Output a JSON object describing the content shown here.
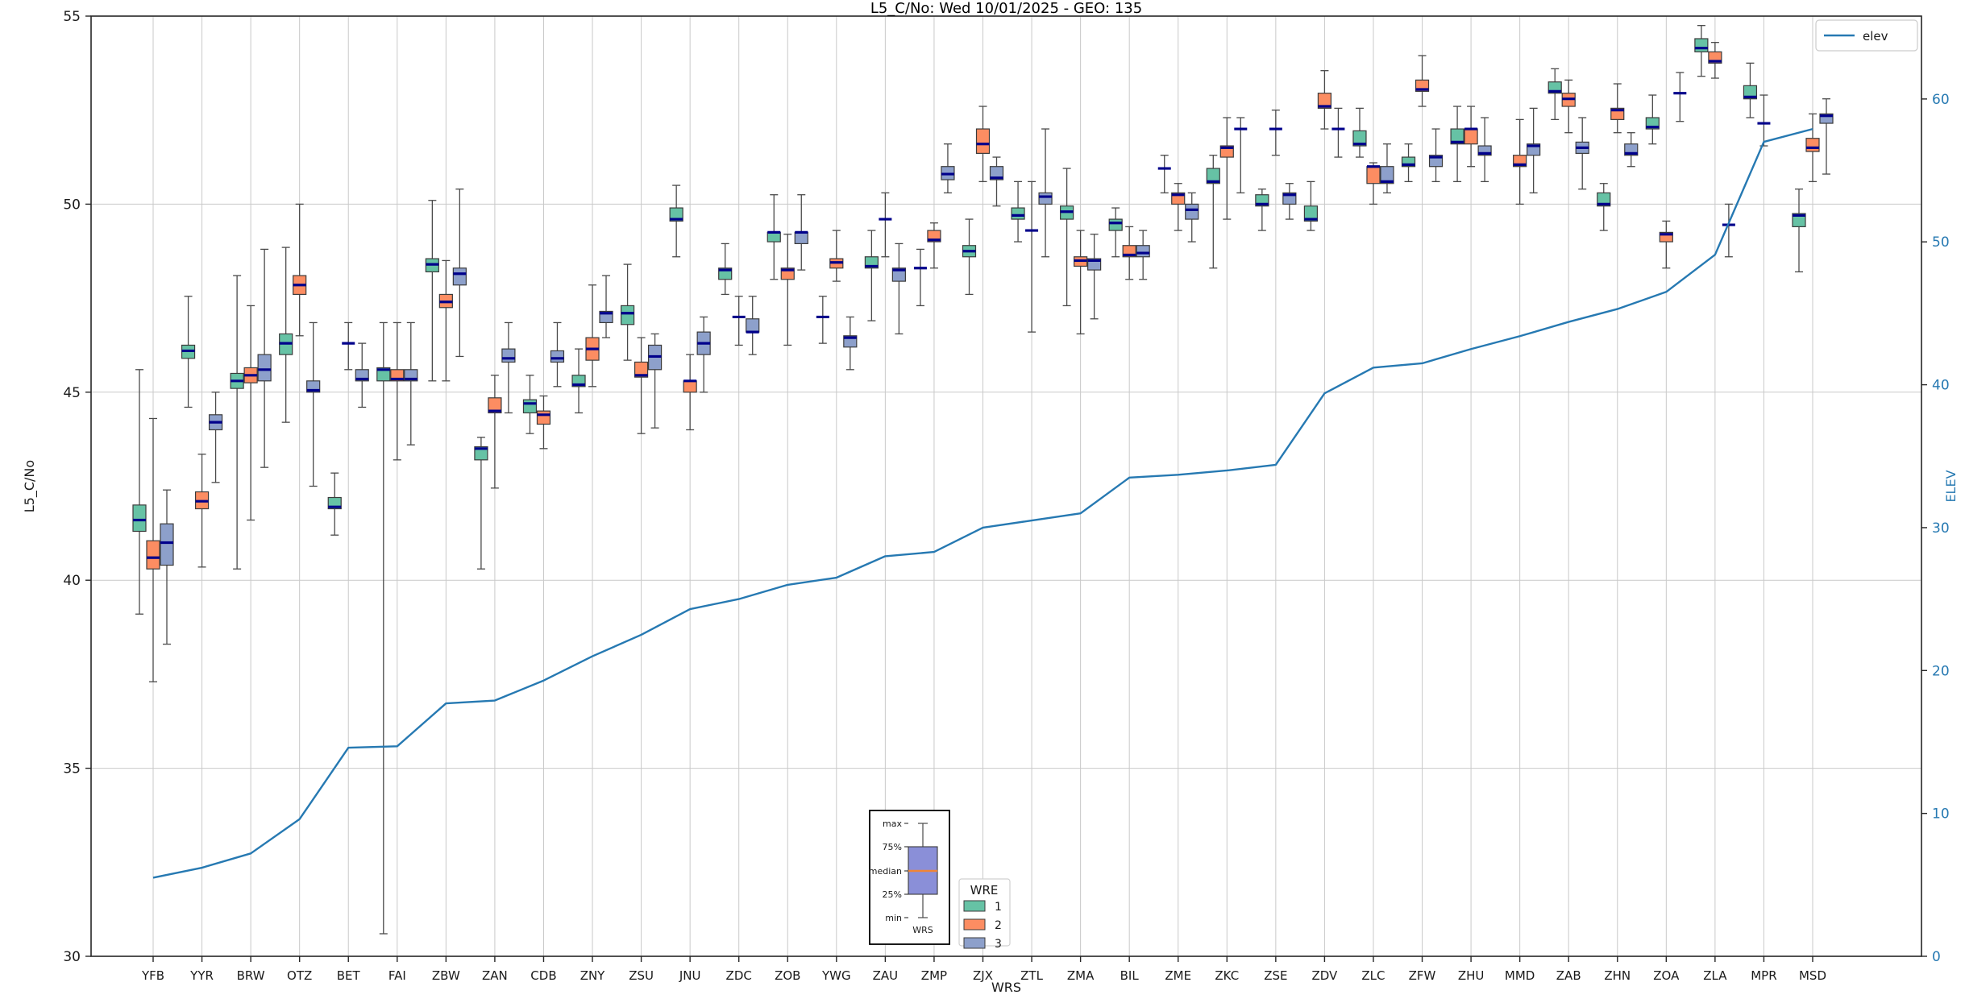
{
  "chart_data": {
    "type": "boxplot+line",
    "title": "L5_C/No: Wed 10/01/2025 - GEO: 135",
    "xlabel": "WRS",
    "ylabel": "L5_C/No",
    "y2label": "ELEV",
    "ylim": [
      30,
      55
    ],
    "yticks": [
      30,
      35,
      40,
      45,
      50,
      55
    ],
    "y2lim": [
      0,
      65.8
    ],
    "y2ticks": [
      0,
      10,
      20,
      30,
      40,
      50,
      60
    ],
    "grid": true,
    "legend_position": "upper-right",
    "categories": [
      "YFB",
      "YYR",
      "BRW",
      "OTZ",
      "BET",
      "FAI",
      "ZBW",
      "ZAN",
      "CDB",
      "ZNY",
      "ZSU",
      "JNU",
      "ZDC",
      "ZOB",
      "YWG",
      "ZAU",
      "ZMP",
      "ZJX",
      "ZTL",
      "ZMA",
      "BIL",
      "ZME",
      "ZKC",
      "ZSE",
      "ZDV",
      "ZLC",
      "ZFW",
      "ZHU",
      "MMD",
      "ZAB",
      "ZHN",
      "ZOA",
      "ZLA",
      "MPR",
      "MSD"
    ],
    "box_value_order": [
      "median",
      "q1",
      "q3",
      "whisker_low",
      "whisker_high"
    ],
    "series": [
      {
        "name": "1",
        "color": "#66c2a5",
        "boxes": [
          [
            41.6,
            41.3,
            42.0,
            39.1,
            45.6
          ],
          [
            46.1,
            45.9,
            46.25,
            44.6,
            47.55
          ],
          [
            45.3,
            45.1,
            45.5,
            40.3,
            48.1
          ],
          [
            46.3,
            46.0,
            46.55,
            44.2,
            48.85
          ],
          [
            41.95,
            41.9,
            42.2,
            41.2,
            42.85
          ],
          [
            45.6,
            45.3,
            45.65,
            30.6,
            46.85
          ],
          [
            48.4,
            48.2,
            48.55,
            45.3,
            50.1
          ],
          [
            43.5,
            43.2,
            43.55,
            40.3,
            43.8
          ],
          [
            44.7,
            44.45,
            44.8,
            43.9,
            45.45
          ],
          [
            45.2,
            45.15,
            45.45,
            44.45,
            46.15
          ],
          [
            47.1,
            46.8,
            47.3,
            45.85,
            48.4
          ],
          [
            49.6,
            49.55,
            49.9,
            48.6,
            50.5
          ],
          [
            48.25,
            48.0,
            48.3,
            47.6,
            48.95
          ],
          [
            49.25,
            49.0,
            49.25,
            48.0,
            50.25
          ],
          [
            47.0,
            47.0,
            47.0,
            46.3,
            47.55
          ],
          [
            48.35,
            48.3,
            48.6,
            46.9,
            49.3
          ],
          [
            48.3,
            48.3,
            48.3,
            47.3,
            48.8
          ],
          [
            48.75,
            48.6,
            48.9,
            47.6,
            49.6
          ],
          [
            49.7,
            49.6,
            49.9,
            49.0,
            50.6
          ],
          [
            49.8,
            49.6,
            49.95,
            47.3,
            50.95
          ],
          [
            49.5,
            49.3,
            49.6,
            48.6,
            49.9
          ],
          [
            50.95,
            50.95,
            50.95,
            50.3,
            51.3
          ],
          [
            50.6,
            50.55,
            50.95,
            48.3,
            51.3
          ],
          [
            50.0,
            49.95,
            50.25,
            49.3,
            50.4
          ],
          [
            49.6,
            49.55,
            49.95,
            49.3,
            50.6
          ],
          [
            51.6,
            51.55,
            51.95,
            51.25,
            52.55
          ],
          [
            51.05,
            51.0,
            51.25,
            50.6,
            51.6
          ],
          [
            51.65,
            51.6,
            52.0,
            50.6,
            52.6
          ],
          null,
          [
            53.0,
            52.95,
            53.25,
            52.25,
            53.6
          ],
          [
            50.0,
            49.95,
            50.3,
            49.3,
            50.55
          ],
          [
            52.05,
            52.0,
            52.3,
            51.6,
            52.9
          ],
          [
            54.15,
            54.05,
            54.4,
            53.4,
            54.75
          ],
          [
            52.85,
            52.8,
            53.15,
            52.3,
            53.75
          ],
          [
            49.7,
            49.4,
            49.75,
            48.2,
            50.4
          ]
        ]
      },
      {
        "name": "2",
        "color": "#fc8d62",
        "boxes": [
          [
            40.6,
            40.3,
            41.05,
            37.3,
            44.3
          ],
          [
            42.1,
            41.9,
            42.35,
            40.35,
            43.35
          ],
          [
            45.45,
            45.25,
            45.65,
            41.6,
            47.3
          ],
          [
            47.85,
            47.6,
            48.1,
            46.5,
            50.0
          ],
          [
            46.3,
            46.3,
            46.3,
            45.6,
            46.85
          ],
          [
            45.35,
            45.3,
            45.6,
            43.2,
            46.85
          ],
          [
            47.4,
            47.25,
            47.6,
            45.3,
            48.5
          ],
          [
            44.5,
            44.45,
            44.85,
            42.45,
            45.45
          ],
          [
            44.4,
            44.15,
            44.5,
            43.5,
            44.9
          ],
          [
            46.15,
            45.85,
            46.45,
            45.15,
            47.85
          ],
          [
            45.45,
            45.4,
            45.8,
            43.9,
            46.45
          ],
          [
            45.3,
            45.0,
            45.3,
            44.0,
            46.0
          ],
          [
            47.0,
            47.0,
            47.0,
            46.25,
            47.55
          ],
          [
            48.25,
            48.0,
            48.3,
            46.25,
            49.2
          ],
          [
            48.45,
            48.3,
            48.55,
            47.95,
            49.3
          ],
          [
            49.6,
            49.6,
            49.6,
            48.6,
            50.3
          ],
          [
            49.05,
            49.0,
            49.3,
            48.3,
            49.5
          ],
          [
            51.6,
            51.35,
            52.0,
            50.6,
            52.6
          ],
          [
            49.3,
            49.3,
            49.3,
            46.6,
            50.6
          ],
          [
            48.5,
            48.35,
            48.6,
            46.55,
            49.3
          ],
          [
            48.65,
            48.6,
            48.9,
            48.0,
            49.4
          ],
          [
            50.25,
            50.0,
            50.3,
            49.3,
            50.55
          ],
          [
            51.5,
            51.25,
            51.55,
            49.6,
            52.3
          ],
          [
            52.0,
            52.0,
            52.0,
            51.3,
            52.5
          ],
          [
            52.6,
            52.55,
            52.95,
            52.0,
            53.55
          ],
          [
            51.0,
            50.55,
            51.0,
            50.0,
            51.1
          ],
          [
            53.05,
            53.0,
            53.3,
            52.6,
            53.95
          ],
          [
            52.0,
            51.6,
            52.0,
            51.0,
            52.6
          ],
          [
            51.05,
            51.0,
            51.3,
            50.0,
            52.25
          ],
          [
            52.8,
            52.6,
            52.95,
            51.9,
            53.3
          ],
          [
            52.5,
            52.25,
            52.55,
            51.9,
            53.2
          ],
          [
            49.2,
            49.0,
            49.25,
            48.3,
            49.55
          ],
          [
            53.8,
            53.75,
            54.05,
            53.35,
            54.3
          ],
          [
            52.15,
            52.15,
            52.15,
            51.55,
            52.9
          ],
          [
            51.5,
            51.4,
            51.75,
            50.6,
            52.4
          ]
        ]
      },
      {
        "name": "3",
        "color": "#8da0cb",
        "boxes": [
          [
            41.0,
            40.4,
            41.5,
            38.3,
            42.4
          ],
          [
            44.2,
            44.0,
            44.4,
            42.6,
            45.0
          ],
          [
            45.6,
            45.3,
            46.0,
            43.0,
            48.8
          ],
          [
            45.05,
            45.0,
            45.3,
            42.5,
            46.85
          ],
          [
            45.35,
            45.3,
            45.6,
            44.6,
            46.3
          ],
          [
            45.35,
            45.3,
            45.6,
            43.6,
            46.85
          ],
          [
            48.15,
            47.85,
            48.3,
            45.95,
            50.4
          ],
          [
            45.9,
            45.8,
            46.15,
            44.45,
            46.85
          ],
          [
            45.9,
            45.8,
            46.1,
            45.15,
            46.85
          ],
          [
            47.1,
            46.85,
            47.15,
            46.45,
            48.1
          ],
          [
            45.95,
            45.6,
            46.25,
            44.05,
            46.55
          ],
          [
            46.3,
            46.0,
            46.6,
            45.0,
            47.0
          ],
          [
            46.6,
            46.6,
            46.95,
            46.0,
            47.55
          ],
          [
            49.25,
            48.95,
            49.25,
            48.25,
            50.25
          ],
          [
            46.45,
            46.2,
            46.5,
            45.6,
            47.0
          ],
          [
            48.25,
            47.95,
            48.3,
            46.55,
            48.95
          ],
          [
            50.8,
            50.65,
            51.0,
            50.3,
            51.6
          ],
          [
            50.7,
            50.65,
            51.0,
            49.95,
            51.25
          ],
          [
            50.2,
            50.0,
            50.3,
            48.6,
            52.0
          ],
          [
            48.5,
            48.25,
            48.55,
            46.95,
            49.2
          ],
          [
            48.7,
            48.6,
            48.9,
            48.0,
            49.3
          ],
          [
            49.85,
            49.6,
            50.0,
            49.0,
            50.3
          ],
          [
            52.0,
            52.0,
            52.0,
            50.3,
            52.3
          ],
          [
            50.25,
            50.0,
            50.3,
            49.6,
            50.55
          ],
          [
            52.0,
            52.0,
            52.0,
            51.25,
            52.55
          ],
          [
            50.6,
            50.55,
            51.0,
            50.3,
            51.6
          ],
          [
            51.25,
            51.0,
            51.3,
            50.6,
            52.0
          ],
          [
            51.35,
            51.3,
            51.55,
            50.6,
            52.3
          ],
          [
            51.55,
            51.3,
            51.6,
            50.3,
            52.55
          ],
          [
            51.5,
            51.35,
            51.65,
            50.4,
            52.3
          ],
          [
            51.35,
            51.3,
            51.6,
            51.0,
            51.9
          ],
          [
            52.95,
            52.95,
            52.95,
            52.2,
            53.5
          ],
          [
            49.45,
            49.45,
            49.45,
            48.6,
            50.0
          ],
          null,
          [
            52.35,
            52.15,
            52.4,
            50.8,
            52.8
          ]
        ]
      }
    ],
    "elev_line": {
      "name": "elev",
      "color": "#2679b2",
      "values": [
        5.5,
        6.2,
        7.2,
        9.6,
        14.6,
        14.7,
        17.7,
        17.9,
        19.3,
        21.0,
        22.5,
        24.3,
        25.0,
        26.0,
        26.5,
        28.0,
        28.3,
        30.0,
        30.5,
        31.0,
        33.5,
        33.7,
        34.0,
        34.4,
        39.4,
        41.2,
        41.5,
        42.5,
        43.4,
        44.4,
        45.3,
        46.5,
        49.1,
        57.0,
        57.9
      ]
    },
    "elev_legend": {
      "label": "elev"
    },
    "wre_legend": {
      "title": "WRE",
      "entries": [
        {
          "label": "1",
          "color": "#66c2a5"
        },
        {
          "label": "2",
          "color": "#fc8d62"
        },
        {
          "label": "3",
          "color": "#8da0cb"
        }
      ]
    },
    "inset_legend": {
      "labels": [
        "max",
        "75%",
        "median",
        "25%",
        "min"
      ],
      "xlabel": "WRS",
      "box_color": "#8a8fd8",
      "median_color": "#ef8536"
    },
    "style_colors": {
      "median": "#00008b",
      "box_edge": "#3b3b3b",
      "whisker": "#4a4a4a",
      "grid": "#c9c9c9",
      "spine": "#262626",
      "right_axis_text": "#2679b2"
    }
  }
}
